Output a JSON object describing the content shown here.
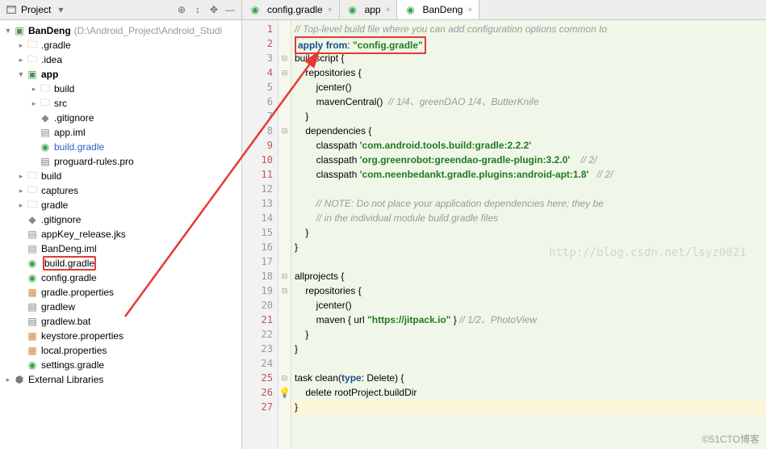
{
  "panel": {
    "title": "Project"
  },
  "project": {
    "name": "BanDeng",
    "path": "(D:\\Android_Project\\Android_Studi"
  },
  "tree": {
    "gradle_dir": ".gradle",
    "idea_dir": ".idea",
    "app": "app",
    "app_build": "build",
    "app_src": "src",
    "app_gitignore": ".gitignore",
    "app_iml": "app.iml",
    "app_build_gradle": "build.gradle",
    "app_proguard": "proguard-rules.pro",
    "root_build": "build",
    "captures": "captures",
    "gradle": "gradle",
    "gitignore": ".gitignore",
    "appkey": "appKey_release.jks",
    "bandeng_iml": "BanDeng.iml",
    "build_gradle": "build.gradle",
    "config_gradle": "config.gradle",
    "gradle_props": "gradle.properties",
    "gradlew": "gradlew",
    "gradlew_bat": "gradlew.bat",
    "keystore_props": "keystore.properties",
    "local_props": "local.properties",
    "settings_gradle": "settings.gradle",
    "ext_libs": "External Libraries"
  },
  "tabs": {
    "t1": "config.gradle",
    "t2": "app",
    "t3": "BanDeng"
  },
  "code": {
    "l1_cmt": "// Top-level build file where you can add configuration options common to",
    "l2_apply": "apply",
    "l2_from": "from",
    "l2_colon": ": ",
    "l2_str": "\"config.gradle\"",
    "l3": "buildscript {",
    "l4": "    repositories {",
    "l5": "        jcenter()",
    "l6": "        mavenCentral()",
    "l6_cmt": "  // 1/4、greenDAO 1/4、ButterKnife",
    "l7": "    }",
    "l8": "    dependencies {",
    "l9": "        classpath ",
    "l9_str": "'com.android.tools.build:gradle:2.2.2'",
    "l10": "        classpath ",
    "l10_str": "'org.greenrobot:greendao-gradle-plugin:3.2.0'",
    "l10_cmt": "    // 2/",
    "l11": "        classpath ",
    "l11_str": "'com.neenbedankt.gradle.plugins:android-apt:1.8'",
    "l11_cmt": "   // 2/",
    "l13_cmt": "        // NOTE: Do not place your application dependencies here; they be",
    "l14_cmt": "        // in the individual module build.gradle files",
    "l15": "    }",
    "l16": "}",
    "l18": "allprojects {",
    "l19": "    repositories {",
    "l20": "        jcenter()",
    "l21a": "        maven { url ",
    "l21_str": "\"https://jitpack.io\"",
    "l21b": " } ",
    "l21_cmt": "// 1/2、PhotoView",
    "l22": "    }",
    "l23": "}",
    "l25a": "task clean(",
    "l25_type": "type",
    "l25b": ": Delete) {",
    "l26": "    delete rootProject.buildDir",
    "l27": "}"
  },
  "watermarks": {
    "w1": "http://blog.csdn.net/lsyz0021",
    "w2": "©51CTO博客"
  }
}
